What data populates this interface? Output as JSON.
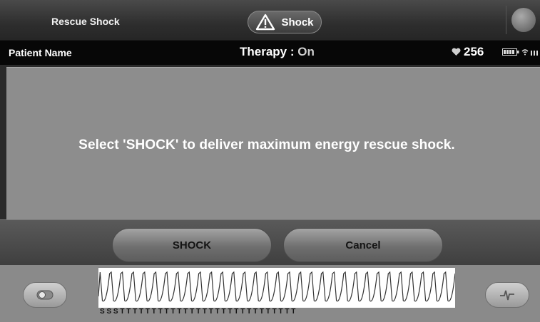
{
  "header": {
    "title": "Rescue Shock",
    "tab_label": "Shock",
    "tab_icon": "warning-icon",
    "right_icon": "device-icon"
  },
  "status": {
    "patient_name": "Patient Name",
    "therapy_label": "Therapy : ",
    "therapy_value": "On",
    "heart_icon": "heart-icon",
    "heart_rate": "256",
    "battery_icon": "battery-icon",
    "signal_icon": "signal-icon"
  },
  "message": {
    "text": "Select 'SHOCK' to deliver maximum energy rescue shock."
  },
  "buttons": {
    "shock": "SHOCK",
    "cancel": "Cancel"
  },
  "ecg": {
    "beats_shown": 32,
    "markers": "S S S T T  T T T T T T T T T T T T T T T T T T T T T T T T T T"
  },
  "colors": {
    "statusbar": "#070707",
    "main_panel": "#8d8d8d",
    "text": "#ffffff"
  }
}
